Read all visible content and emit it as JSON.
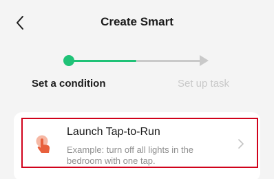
{
  "header": {
    "title": "Create Smart",
    "back_icon": "chevron-left-icon"
  },
  "stepper": {
    "steps": [
      {
        "label": "Set a condition",
        "state": "active"
      },
      {
        "label": "Set up task",
        "state": "inactive"
      }
    ],
    "progress_color": "#1fc277",
    "inactive_color": "#c9c9c9"
  },
  "options": [
    {
      "title": "Launch Tap-to-Run",
      "description": "Example: turn off all lights in the bedroom with one tap.",
      "icon": "tap-finger-icon",
      "icon_color": "#e8603c",
      "highlight_color": "#d0021b"
    }
  ]
}
